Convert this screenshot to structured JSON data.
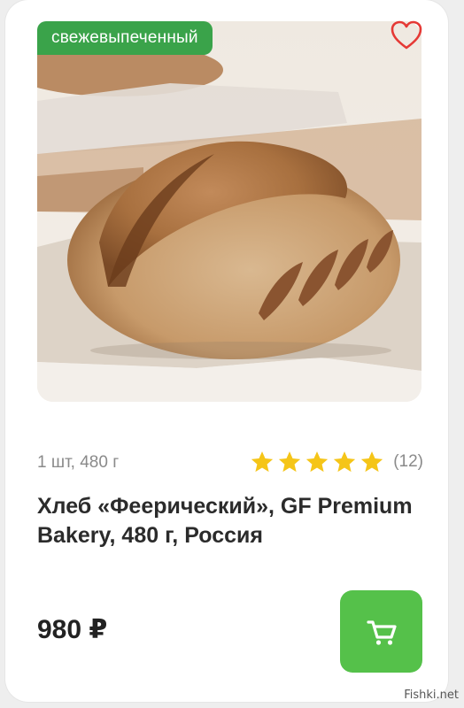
{
  "product": {
    "badge": "свежевыпеченный",
    "quantity_weight": "1 шт, 480 г",
    "rating": {
      "stars": 5,
      "reviews_count": "(12)"
    },
    "title": "Хлеб «Феерический», GF Premium Bakery, 480 г, Россия",
    "price": "980 ₽"
  },
  "icons": {
    "favorite": "heart-outline-icon",
    "rating_star": "star-icon",
    "cart": "shopping-cart-icon"
  },
  "colors": {
    "badge_bg": "#3aa34a",
    "cart_button_bg": "#55c14a",
    "star": "#f5c518",
    "heart": "#e53935"
  },
  "watermark": "Fishki.net"
}
